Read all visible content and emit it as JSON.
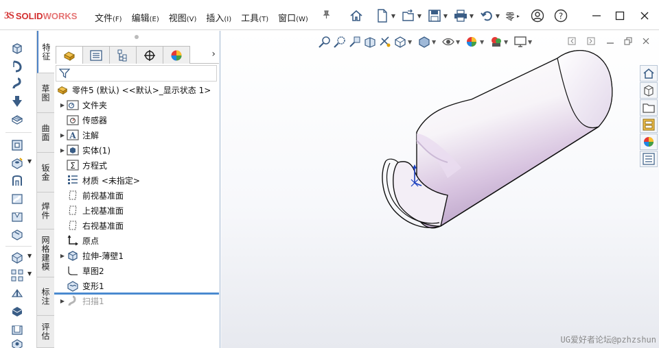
{
  "app": {
    "logo_ds": "3S",
    "logo_solid": "SOLID",
    "logo_works": "WORKS"
  },
  "menus": [
    {
      "label": "文件",
      "key": "(F)"
    },
    {
      "label": "编辑",
      "key": "(E)"
    },
    {
      "label": "视图",
      "key": "(V)"
    },
    {
      "label": "插入",
      "key": "(I)"
    },
    {
      "label": "工具",
      "key": "(T)"
    },
    {
      "label": "窗口",
      "key": "(W)"
    }
  ],
  "toolbar_overflow": "零",
  "vertical_tabs": [
    "特征",
    "草图",
    "曲面",
    "钣金",
    "焊件",
    "网格建模",
    "标注",
    "评估"
  ],
  "tree": {
    "root": "零件5 (默认) <<默认>_显示状态 1>",
    "items": [
      {
        "label": "文件夹",
        "icon": "folder-icon",
        "expandable": true
      },
      {
        "label": "传感器",
        "icon": "sensor-icon",
        "expandable": false
      },
      {
        "label": "注解",
        "icon": "annotation-icon",
        "expandable": true
      },
      {
        "label": "实体(1)",
        "icon": "solid-body-icon",
        "expandable": true
      },
      {
        "label": "方程式",
        "icon": "equation-icon",
        "expandable": false
      },
      {
        "label": "材质 <未指定>",
        "icon": "material-icon",
        "expandable": false
      },
      {
        "label": "前视基准面",
        "icon": "plane-icon",
        "expandable": false
      },
      {
        "label": "上视基准面",
        "icon": "plane-icon",
        "expandable": false
      },
      {
        "label": "右视基准面",
        "icon": "plane-icon",
        "expandable": false
      },
      {
        "label": "原点",
        "icon": "origin-icon",
        "expandable": false
      },
      {
        "label": "拉伸-薄壁1",
        "icon": "extrude-icon",
        "expandable": true
      },
      {
        "label": "草图2",
        "icon": "sketch-icon",
        "expandable": false
      },
      {
        "label": "变形1",
        "icon": "deform-icon",
        "expandable": false
      },
      {
        "label": "扫描1",
        "icon": "sweep-icon",
        "expandable": true,
        "suppressed": true
      }
    ]
  },
  "watermark": "UG爱好者论坛@pzhzshun",
  "colors": {
    "accent": "#4a8ad0",
    "logo_red": "#d32f2f",
    "icon_blue": "#3a5d86",
    "model_tint": "#c9b6d6"
  }
}
